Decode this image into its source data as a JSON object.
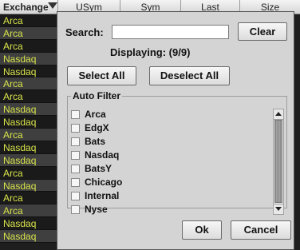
{
  "table": {
    "columns": [
      "Exchange",
      "USym",
      "Sym",
      "Last",
      "Size"
    ],
    "rows": [
      "Arca",
      "Arca",
      "Arca",
      "Nasdaq",
      "Nasdaq",
      "Arca",
      "Arca",
      "Nasdaq",
      "Nasdaq",
      "Arca",
      "Nasdaq",
      "Nasdaq",
      "Arca",
      "Nasdaq",
      "Arca",
      "Arca",
      "Nasdaq",
      "Nasdaq"
    ]
  },
  "dialog": {
    "search_label": "Search:",
    "search_value": "",
    "clear_label": "Clear",
    "displaying": "Displaying: (9/9)",
    "select_all": "Select All",
    "deselect_all": "Deselect All",
    "auto_filter_title": "Auto Filter",
    "items": [
      "Arca",
      "EdgX",
      "Bats",
      "Nasdaq",
      "BatsY",
      "Chicago",
      "Internal",
      "Nyse"
    ],
    "ok": "Ok",
    "cancel": "Cancel"
  },
  "colors": {
    "row_text": "#d8e44a",
    "row_even": "#3f3f3f",
    "row_odd": "#1a1a1a",
    "dialog_bg": "#d4d4d4"
  },
  "icons": {
    "filter": "filter-funnel-icon",
    "scroll_up": "arrow-up-icon",
    "scroll_down": "arrow-down-icon"
  }
}
